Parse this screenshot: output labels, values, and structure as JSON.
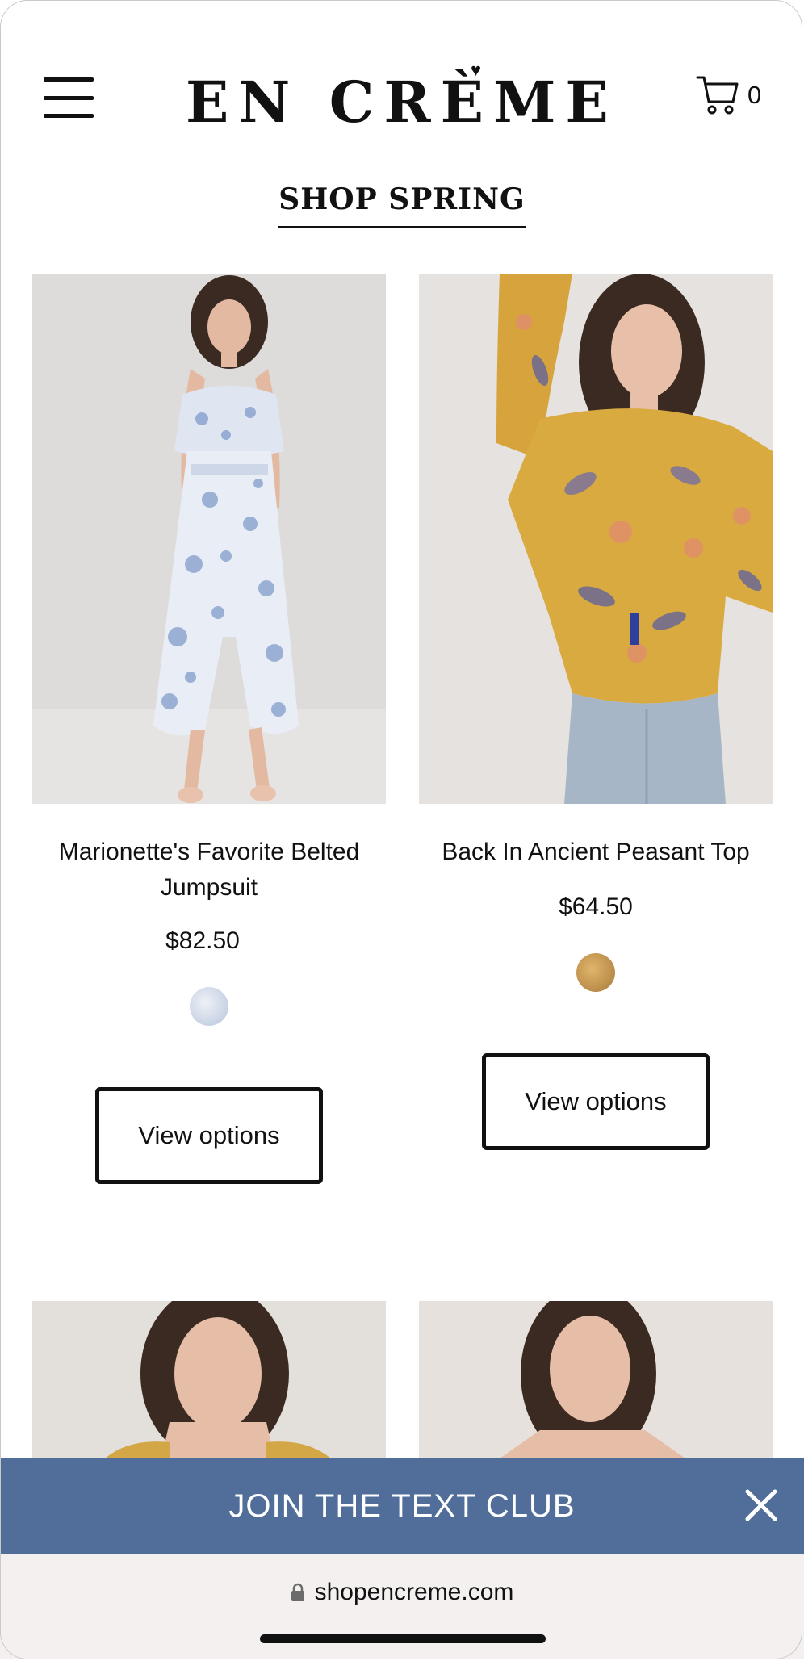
{
  "header": {
    "logo_text": "EN CRÈME",
    "cart_count": "0",
    "menu_icon": "hamburger-menu-icon",
    "cart_icon": "shopping-cart-icon"
  },
  "section": {
    "title": "SHOP SPRING"
  },
  "products": [
    {
      "name": "Marionette's Favorite Belted Jumpsuit",
      "price": "$82.50",
      "swatch_color": "#c9d4e6",
      "button_label": "View options"
    },
    {
      "name": "Back In Ancient Peasant Top",
      "price": "$64.50",
      "swatch_color": "#c9974a",
      "button_label": "View options"
    }
  ],
  "banner": {
    "text": "JOIN THE TEXT CLUB",
    "color": "#516e9a",
    "close_icon": "close-icon"
  },
  "browser": {
    "url": "shopencreme.com",
    "lock_icon": "lock-icon"
  }
}
